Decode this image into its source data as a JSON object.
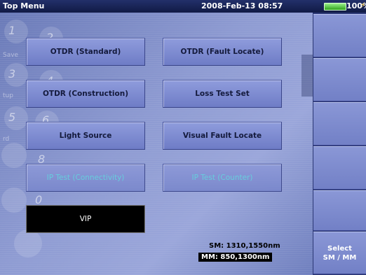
{
  "titlebar": {
    "title": "Top Menu",
    "datetime": "2008-Feb-13 08:57",
    "battery_pct": "100%",
    "battery_level": 1.0,
    "battery_color": "#4cc33a"
  },
  "background": {
    "numbers": [
      "1",
      "2",
      "3",
      "4",
      "5",
      "6",
      "8",
      "0"
    ],
    "labels": [
      "Save",
      "tup",
      "rd"
    ]
  },
  "menu": {
    "otdr_standard": "OTDR (Standard)",
    "otdr_fault_locate": "OTDR (Fault Locate)",
    "otdr_construction": "OTDR (Construction)",
    "loss_test_set": "Loss Test Set",
    "light_source": "Light Source",
    "visual_fault_locate": "Visual Fault Locate",
    "ip_test_connectivity": "IP Test (Connectivity)",
    "ip_test_counter": "IP Test (Counter)",
    "vip": "VIP"
  },
  "fiber": {
    "sm": "SM: 1310,1550nm",
    "mm": "MM:  850,1300nm"
  },
  "softkeys": {
    "key1": "",
    "key2": "",
    "key3": "",
    "key4": "",
    "key5": "",
    "select": "Select\nSM / MM"
  }
}
